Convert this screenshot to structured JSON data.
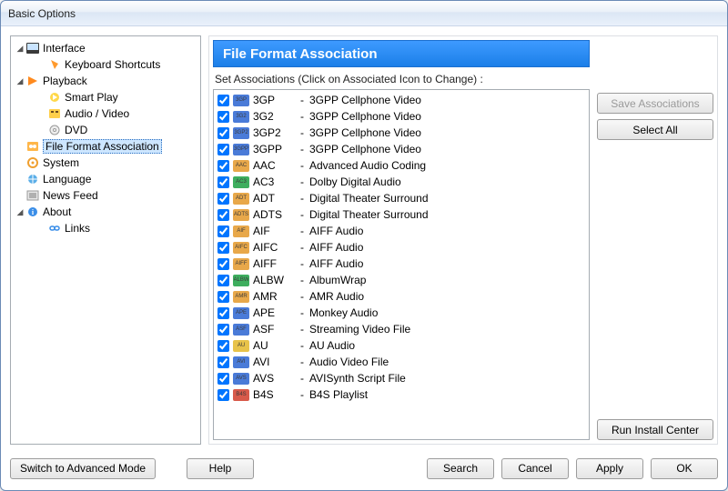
{
  "window": {
    "title": "Basic Options"
  },
  "tree": [
    {
      "label": "Interface",
      "depth": 0,
      "expandable": true,
      "icon": "interface"
    },
    {
      "label": "Keyboard Shortcuts",
      "depth": 1,
      "icon": "keyboard"
    },
    {
      "label": "Playback",
      "depth": 0,
      "expandable": true,
      "icon": "playback"
    },
    {
      "label": "Smart Play",
      "depth": 1,
      "icon": "smartplay"
    },
    {
      "label": "Audio / Video",
      "depth": 1,
      "icon": "av"
    },
    {
      "label": "DVD",
      "depth": 1,
      "icon": "dvd"
    },
    {
      "label": "File Format Association",
      "depth": 0,
      "icon": "file-assoc",
      "selected": true
    },
    {
      "label": "System",
      "depth": 0,
      "icon": "system"
    },
    {
      "label": "Language",
      "depth": 0,
      "icon": "language"
    },
    {
      "label": "News Feed",
      "depth": 0,
      "icon": "news"
    },
    {
      "label": "About",
      "depth": 0,
      "expandable": true,
      "icon": "about"
    },
    {
      "label": "Links",
      "depth": 1,
      "icon": "links"
    }
  ],
  "header": {
    "title": "File Format Association"
  },
  "instruction": "Set Associations (Click on Associated Icon to Change) :",
  "side_buttons": {
    "save": "Save Associations",
    "select_all": "Select All",
    "run_install": "Run Install Center"
  },
  "bottom_buttons": {
    "switch": "Switch to Advanced Mode",
    "help": "Help",
    "search": "Search",
    "cancel": "Cancel",
    "apply": "Apply",
    "ok": "OK"
  },
  "formats": [
    {
      "ext": "3GP",
      "desc": "3GPP Cellphone Video",
      "checked": true,
      "color": "#4a7bd8"
    },
    {
      "ext": "3G2",
      "desc": "3GPP Cellphone Video",
      "checked": true,
      "color": "#4a7bd8"
    },
    {
      "ext": "3GP2",
      "desc": "3GPP Cellphone Video",
      "checked": true,
      "color": "#4a7bd8"
    },
    {
      "ext": "3GPP",
      "desc": "3GPP Cellphone Video",
      "checked": true,
      "color": "#4a7bd8"
    },
    {
      "ext": "AAC",
      "desc": "Advanced Audio Coding",
      "checked": true,
      "color": "#e8a84a"
    },
    {
      "ext": "AC3",
      "desc": "Dolby Digital Audio",
      "checked": true,
      "color": "#3eae5e"
    },
    {
      "ext": "ADT",
      "desc": "Digital Theater Surround",
      "checked": true,
      "color": "#e8a84a"
    },
    {
      "ext": "ADTS",
      "desc": "Digital Theater Surround",
      "checked": true,
      "color": "#e8a84a"
    },
    {
      "ext": "AIF",
      "desc": "AIFF Audio",
      "checked": true,
      "color": "#e8a84a"
    },
    {
      "ext": "AIFC",
      "desc": "AIFF Audio",
      "checked": true,
      "color": "#e8a84a"
    },
    {
      "ext": "AIFF",
      "desc": "AIFF Audio",
      "checked": true,
      "color": "#e8a84a"
    },
    {
      "ext": "ALBW",
      "desc": "AlbumWrap",
      "checked": true,
      "color": "#3eae5e"
    },
    {
      "ext": "AMR",
      "desc": "AMR Audio",
      "checked": true,
      "color": "#e8a84a"
    },
    {
      "ext": "APE",
      "desc": "Monkey Audio",
      "checked": true,
      "color": "#4a7bd8"
    },
    {
      "ext": "ASF",
      "desc": "Streaming Video File",
      "checked": true,
      "color": "#4a7bd8"
    },
    {
      "ext": "AU",
      "desc": "AU Audio",
      "checked": true,
      "color": "#e8c34a"
    },
    {
      "ext": "AVI",
      "desc": "Audio Video File",
      "checked": true,
      "color": "#4a7bd8"
    },
    {
      "ext": "AVS",
      "desc": "AVISynth Script File",
      "checked": true,
      "color": "#4a7bd8"
    },
    {
      "ext": "B4S",
      "desc": "B4S Playlist",
      "checked": true,
      "color": "#d85a4a"
    }
  ]
}
